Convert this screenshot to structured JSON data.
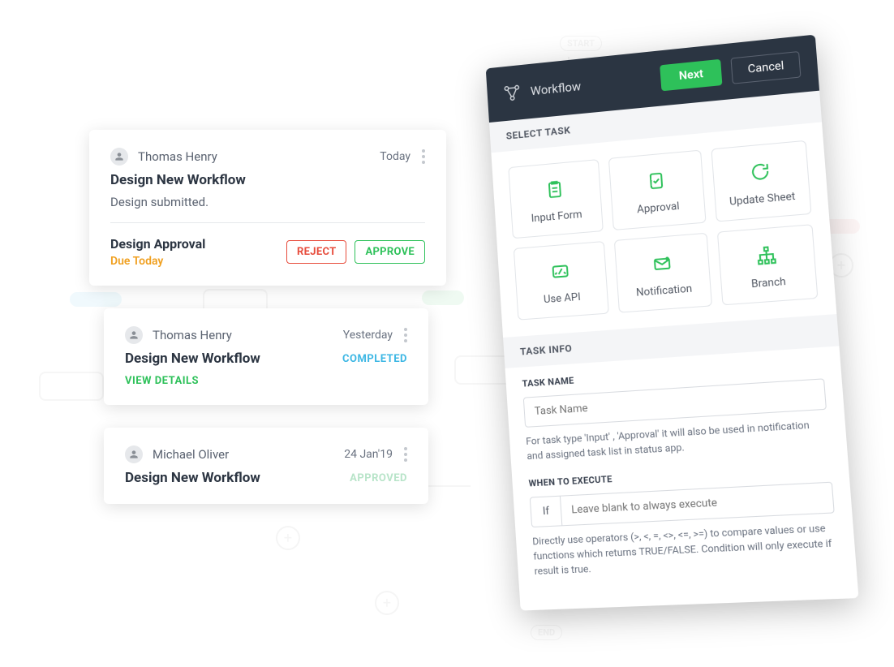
{
  "bg": {
    "start": "START",
    "end": "END"
  },
  "cards": [
    {
      "user": "Thomas Henry",
      "date": "Today",
      "title": "Design New Workflow",
      "message": "Design submitted.",
      "approval_title": "Design Approval",
      "due": "Due Today",
      "reject": "REJECT",
      "approve": "APPROVE"
    },
    {
      "user": "Thomas Henry",
      "date": "Yesterday",
      "title": "Design New Workflow",
      "status": "COMPLETED",
      "view": "VIEW DETAILS"
    },
    {
      "user": "Michael Oliver",
      "date": "24 Jan'19",
      "title": "Design New Workflow",
      "status": "APPROVED"
    }
  ],
  "panel": {
    "title": "Workflow",
    "next": "Next",
    "cancel": "Cancel",
    "select_task": "SELECT TASK",
    "tasks": [
      "Input Form",
      "Approval",
      "Update Sheet",
      "Use API",
      "Notification",
      "Branch"
    ],
    "task_info": "TASK INFO",
    "task_name_label": "TASK NAME",
    "task_name_placeholder": "Task Name",
    "task_name_help": "For task type 'Input' , 'Approval' it will also be used in notification and assigned task list in status app.",
    "when_label": "WHEN TO EXECUTE",
    "if": "If",
    "when_placeholder": "Leave blank to always execute",
    "when_help": "Directly use operators (>, <, =, <>, <=, >=) to compare values or use functions which returns TRUE/FALSE. Condition will only execute if result is true."
  }
}
